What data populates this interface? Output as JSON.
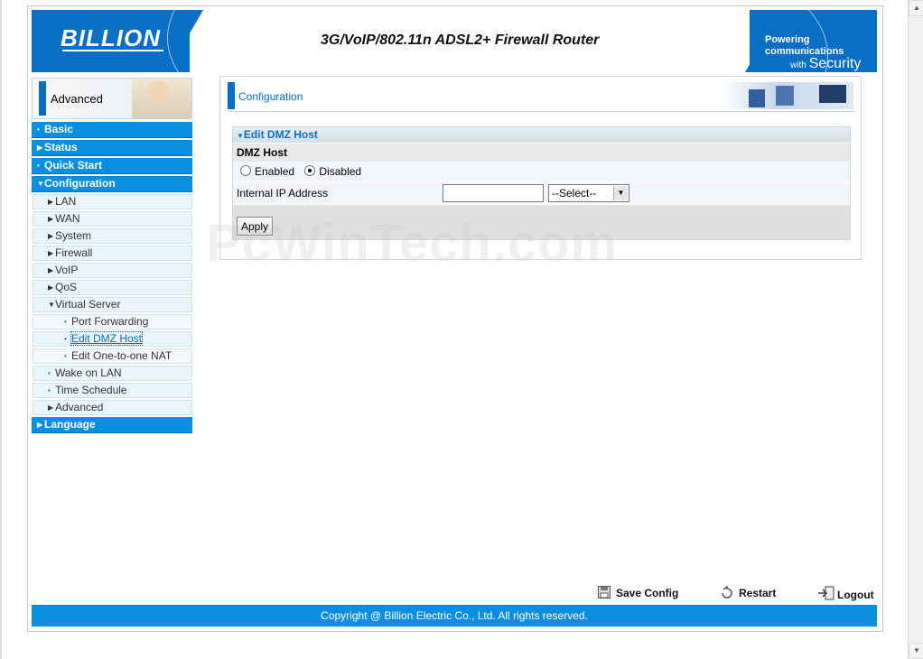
{
  "header": {
    "logo": "BILLION",
    "product_title": "3G/VoIP/802.11n ADSL2+ Firewall Router",
    "tagline_line1": "Powering communications",
    "tagline_line2a": "with ",
    "tagline_line2b": "Security"
  },
  "sidebar": {
    "mode_label": "Advanced",
    "menu": {
      "basic": "Basic",
      "status": "Status",
      "quick_start": "Quick Start",
      "configuration": "Configuration",
      "lan": "LAN",
      "wan": "WAN",
      "system": "System",
      "firewall": "Firewall",
      "voip": "VoIP",
      "qos": "QoS",
      "virtual_server": "Virtual Server",
      "port_forwarding": "Port Forwarding",
      "edit_dmz_host": "Edit DMZ Host",
      "edit_one_to_one_nat": "Edit One-to-one NAT",
      "wake_on_lan": "Wake on LAN",
      "time_schedule": "Time Schedule",
      "advanced": "Advanced",
      "language": "Language"
    }
  },
  "main": {
    "section_title": "Configuration",
    "panel_title": "Edit DMZ Host",
    "dmz_host_label": "DMZ Host",
    "radio_enabled": "Enabled",
    "radio_disabled": "Disabled",
    "selected_radio": "Disabled",
    "internal_ip_label": "Internal IP Address",
    "internal_ip_value": "",
    "select_value": "--Select--",
    "apply_label": "Apply"
  },
  "watermark": "PcWinTech.com",
  "footer": {
    "save_config": "Save Config",
    "restart": "Restart",
    "logout": "Logout",
    "copyright": "Copyright @ Billion Electric Co., Ltd. All rights reserved."
  },
  "colors": {
    "brand_blue": "#0a6fc4",
    "menu_blue": "#0a8fe0"
  }
}
